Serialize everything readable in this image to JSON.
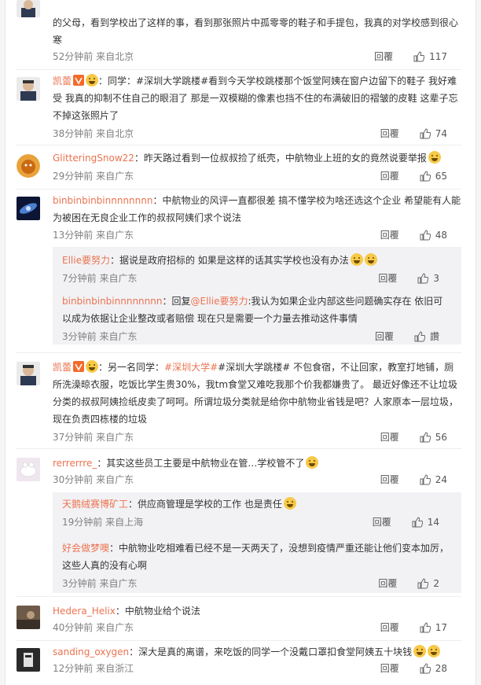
{
  "reply_label": "回覆",
  "comments": [
    {
      "avatar": "portrait-avatar",
      "text": "的父母，看到学校出了这样的事，看到那张照片中孤零零的鞋子和手提包，我真的对学校感到很心寒",
      "time": "52分钟前",
      "location": "来自北京",
      "likes": "117"
    },
    {
      "avatar": "portrait-avatar",
      "name": "凯蕾",
      "prefix": "：同学：",
      "text": "#深圳大学跳楼#看到今天学校跳楼那个饭堂阿姨在窗户边留下的鞋子 我好难受 我真的抑制不住自己的眼泪了 那是一双模糊的像素也挡不住的布满破旧的褶皱的皮鞋 这辈子忘不掉这张照片了",
      "time": "38分钟前",
      "location": "来自北京",
      "likes": "74"
    },
    {
      "avatar": "orange-avatar",
      "name": "GlitteringSnow22",
      "text": "：昨天路过看到一位叔叔捡了纸壳，中航物业上班的女的竟然说要举报",
      "time": "29分钟前",
      "location": "来自广东",
      "likes": "65"
    },
    {
      "avatar": "galaxy-avatar",
      "name": "binbinbinbinnnnnnnn",
      "text": "：中航物业的风评一直都很差 搞不懂学校为啥还选这个企业 希望能有人能为被困在无良企业工作的叔叔阿姨们求个说法",
      "time": "13分钟前",
      "location": "来自广东",
      "likes": "48"
    }
  ],
  "replies_a": [
    {
      "name": "Ellie要努力",
      "text": "：据说是政府招标的 如果是这样的话其实学校也没有办法",
      "time": "7分钟前",
      "location": "来自广东",
      "likes": "3"
    },
    {
      "name": "binbinbinbinnnnnnnn",
      "text_a": "：回复",
      "mention": "@Ellie要努力",
      "text_b": ":我认为如果企业内部这些问题确实存在 依旧可以成为依据让企业整改或者赔偿 现在只是需要一个力量去推动这件事情",
      "time": "3分钟前",
      "location": "来自广东",
      "likes": "讚"
    }
  ],
  "comment5": {
    "name": "凯蕾",
    "prefix": "：另一名同学：",
    "tag": "#深圳大学#",
    "text": "#深圳大学跳楼# 不包食宿，不让回家，教室打地铺，厕所洗澡晾衣服，吃饭比学生贵30%，我tm食堂又难吃我那个价我都嫌贵了。 最近好像还不让垃圾分类的叔叔阿姨捡纸皮卖了呵呵。所谓垃圾分类就是给你中航物业省钱是吧？人家原本一层垃圾，现在负责四栋楼的垃圾",
    "time": "37分钟前",
    "location": "来自广东",
    "likes": "56"
  },
  "comment6": {
    "name": "rerrerrre_",
    "text": "：其实这些员工主要是中航物业在管…学校管不了",
    "time": "30分钟前",
    "location": "来自广东",
    "likes": "24"
  },
  "replies_b": [
    {
      "name": "天鹅绒赛博矿工",
      "text": "：供应商管理是学校的工作 也是责任",
      "time": "19分钟前",
      "location": "来自上海",
      "likes": "14"
    },
    {
      "name": "好会做梦噢",
      "text": "：中航物业吃相难看已经不是一天两天了，没想到疫情严重还能让他们变本加厉，这些人真的没有心啊",
      "time": "3分钟前",
      "location": "来自广东",
      "likes": "2"
    }
  ],
  "comment7": {
    "name": "Hedera_Helix",
    "text": "：中航物业给个说法",
    "time": "40分钟前",
    "location": "来自广东",
    "likes": "17"
  },
  "comment8": {
    "name": "sanding_oxygen",
    "text": "：深大是真的离谱，来吃饭的同学一个没戴口罩扣食堂阿姨五十块钱",
    "time": "12分钟前",
    "location": "来自浙江",
    "likes": "28"
  }
}
